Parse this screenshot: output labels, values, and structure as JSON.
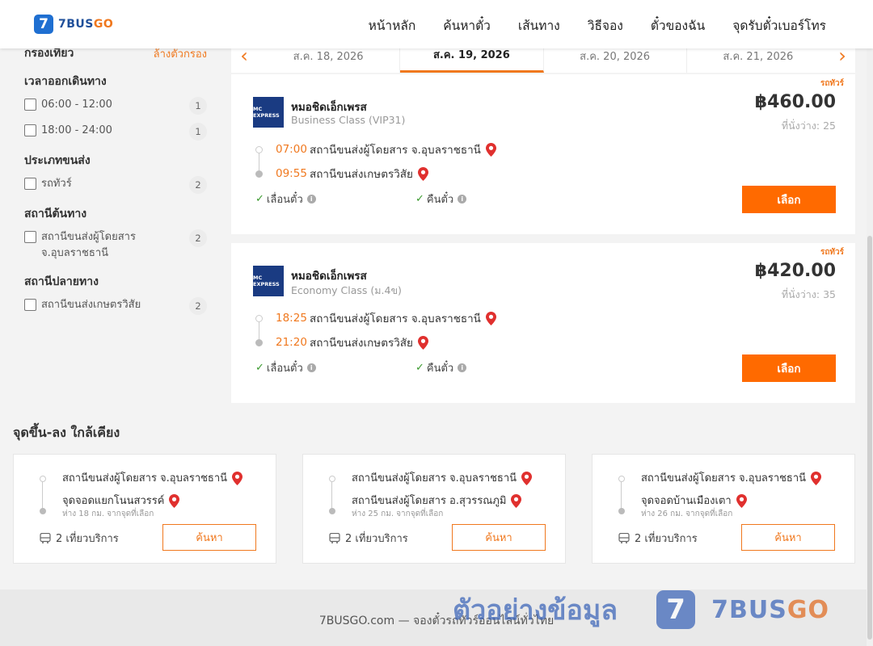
{
  "brand": {
    "name": "7BUSGO",
    "mark": "7",
    "name_main": "7BUS",
    "name_accent": "GO"
  },
  "nav": [
    "หน้าหลัก",
    "ค้นหาตั๋ว",
    "เส้นทาง",
    "วิธีจอง",
    "ตั๋วของฉัน",
    "จุดรับตั๋วเบอร์โทร"
  ],
  "sidebar": {
    "title": "กรองเที่ยว",
    "clear": "ล้างตัวกรอง",
    "groups": [
      {
        "title": "เวลาออกเดินทาง",
        "options": [
          {
            "label": "06:00 - 12:00",
            "count": "1"
          },
          {
            "label": "18:00 - 24:00",
            "count": "1"
          }
        ]
      },
      {
        "title": "ประเภทขนส่ง",
        "options": [
          {
            "label": "รถทัวร์",
            "count": "2"
          }
        ]
      },
      {
        "title": "สถานีต้นทาง",
        "options": [
          {
            "label": "สถานีขนส่งผู้โดยสาร จ.อุบลราชธานี",
            "count": "2"
          }
        ]
      },
      {
        "title": "สถานีปลายทาง",
        "options": [
          {
            "label": "สถานีขนส่งเกษตรวิสัย",
            "count": "2"
          }
        ]
      }
    ]
  },
  "dates": [
    "ส.ค. 18, 2026",
    "ส.ค. 19, 2026",
    "ส.ค. 20, 2026",
    "ส.ค. 21, 2026"
  ],
  "trips": [
    {
      "type": "รถทัวร์",
      "operator": "หมอชิดเอ็กเพรส",
      "class": "Business Class (VIP31)",
      "price": "฿460.00",
      "seats": "ที่นั่งว่าง: 25",
      "depart_time": "07:00",
      "depart_station": "สถานีขนส่งผู้โดยสาร จ.อุบลราชธานี",
      "arrive_time": "09:55",
      "arrive_station": "สถานีขนส่งเกษตรวิสัย",
      "feature1": "เลื่อนตั๋ว",
      "feature2": "คืนตั๋ว",
      "button": "เลือก"
    },
    {
      "type": "รถทัวร์",
      "operator": "หมอชิดเอ็กเพรส",
      "class": "Economy Class (ม.4ข)",
      "price": "฿420.00",
      "seats": "ที่นั่งว่าง: 35",
      "depart_time": "18:25",
      "depart_station": "สถานีขนส่งผู้โดยสาร จ.อุบลราชธานี",
      "arrive_time": "21:20",
      "arrive_station": "สถานีขนส่งเกษตรวิสัย",
      "feature1": "เลื่อนตั๋ว",
      "feature2": "คืนตั๋ว",
      "button": "เลือก"
    }
  ],
  "nearby": {
    "title": "จุดขึ้น-ลง ใกล้เคียง",
    "cards": [
      {
        "from": "สถานีขนส่งผู้โดยสาร จ.อุบลราชธานี",
        "to": "จุดจอดแยกโนนสวรรค์",
        "distance": "ห่าง 18 กม. จากจุดที่เลือก",
        "trips": "2 เที่ยวบริการ",
        "button": "ค้นหา"
      },
      {
        "from": "สถานีขนส่งผู้โดยสาร จ.อุบลราชธานี",
        "to": "สถานีขนส่งผู้โดยสาร อ.สุวรรณภูมิ",
        "distance": "ห่าง 25 กม. จากจุดที่เลือก",
        "trips": "2 เที่ยวบริการ",
        "button": "ค้นหา"
      },
      {
        "from": "สถานีขนส่งผู้โดยสาร จ.อุบลราชธานี",
        "to": "จุดจอดบ้านเมืองเตา",
        "distance": "ห่าง 26 กม. จากจุดที่เลือก",
        "trips": "2 เที่ยวบริการ",
        "button": "ค้นหา"
      }
    ]
  },
  "footer": {
    "text": "7BUSGO.com — จองตั๋วรถทัวร์ออนไลน์ทั่วไทย"
  },
  "watermark": {
    "text": "ตัวอย่างข้อมูล",
    "mark": "7",
    "brand_main": "7BUS",
    "brand_accent": "GO"
  },
  "colors": {
    "accent": "#f0781e",
    "button": "#ff6a00",
    "brand_blue": "#1f6fd1"
  },
  "icons": [
    "chevron-left-icon",
    "chevron-right-icon",
    "map-pin-icon",
    "check-icon",
    "info-icon",
    "bus-icon"
  ]
}
